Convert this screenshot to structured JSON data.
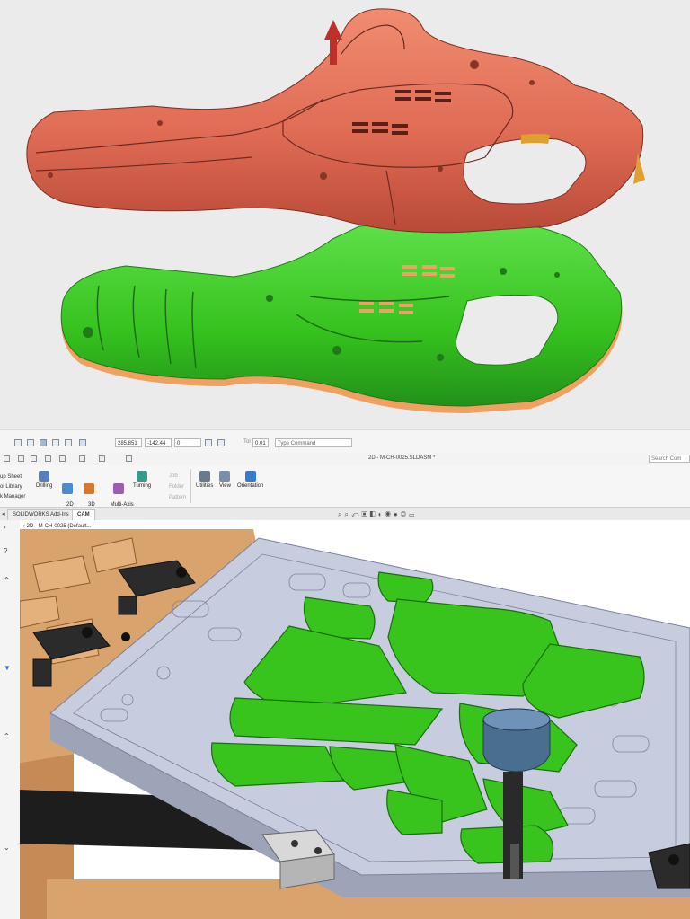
{
  "statusbar": {
    "coord_x": "285.851",
    "coord_y": "-142.44",
    "coord_z": "0",
    "tol_label": "Tol",
    "tol_value": "0.01",
    "command_placeholder": "Type Command"
  },
  "window": {
    "title": "2D - M-CH-0025.SLDASM *",
    "search_placeholder": "Search Com"
  },
  "ribbon": {
    "left_items": [
      "up Sheet",
      "ol Library",
      "k Manager"
    ],
    "buttons": [
      {
        "label": "Drilling",
        "icon": "drill-icon"
      },
      {
        "label": "2D\nMilling",
        "icon": "2d-milling-icon"
      },
      {
        "label": "3D\nMilling",
        "icon": "3d-milling-icon"
      },
      {
        "label": "Multi-Axis\nMilling",
        "icon": "multi-axis-milling-icon"
      },
      {
        "label": "Turning",
        "icon": "turning-icon"
      }
    ],
    "disabled_items": [
      "Job",
      "Folder",
      "Pattern"
    ],
    "tools": [
      {
        "label": "Utilities",
        "icon": "utilities-icon"
      },
      {
        "label": "View",
        "icon": "view-icon"
      },
      {
        "label": "Orientation",
        "icon": "orientation-icon"
      }
    ]
  },
  "tabs": [
    "SOLIDWORKS Add-Ins",
    "CAM"
  ],
  "tree": {
    "root_label": "2D - M-CH-0025 (Default..."
  },
  "colors": {
    "top_part": "#e07058",
    "bottom_part": "#3cc22a",
    "stock_plate": "#b9bfd3",
    "pocket_green": "#38c41c",
    "wood": "#d9a36e",
    "arrow": "#c0302a",
    "tool_holder": "#4a6e90"
  }
}
